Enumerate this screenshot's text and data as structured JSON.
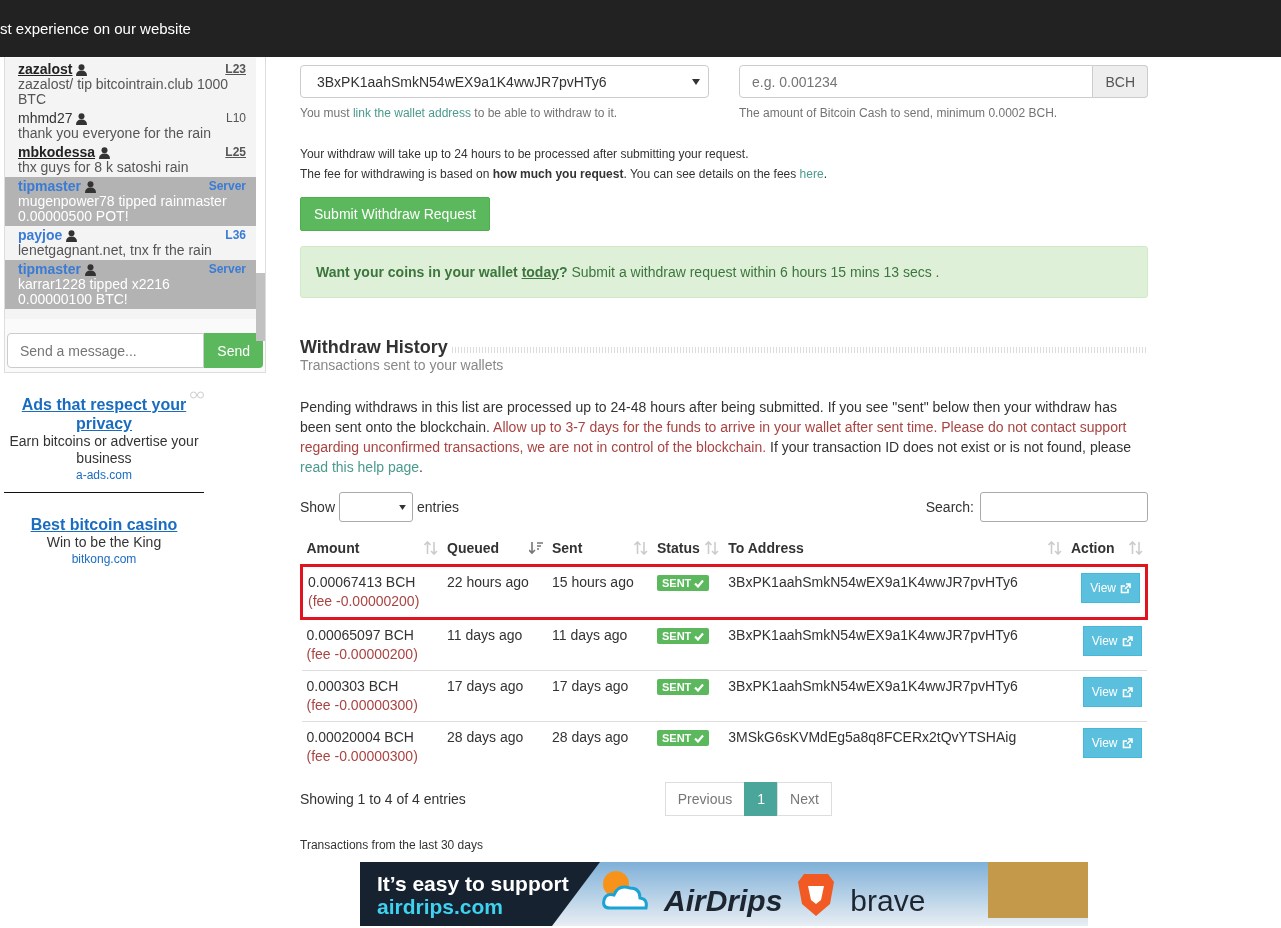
{
  "cookie_bar": {
    "text": "st experience on our website"
  },
  "chat": {
    "messages": [
      {
        "kind": "linked",
        "user": "zazalost",
        "level": "L23",
        "text": "zazalost/ tip bitcointrain.club 1000 BTC"
      },
      {
        "kind": "member",
        "user": "mhmd27",
        "level": "L10",
        "text": "thank you everyone for the rain"
      },
      {
        "kind": "linked",
        "user": "mbkodessa",
        "level": "L25",
        "text": "thx guys for 8 k satoshi rain"
      },
      {
        "kind": "server",
        "user": "tipmaster",
        "level": "Server",
        "text": "mugenpower78 tipped rainmaster 0.00000500 POT!"
      },
      {
        "kind": "vip",
        "user": "payjoe",
        "level": "L36",
        "text": "lenetgagnant.net, tnx fr the rain"
      },
      {
        "kind": "server",
        "user": "tipmaster",
        "level": "Server",
        "text": "karrar1228 tipped x2216 0.00000100 BTC!"
      }
    ],
    "input": {
      "placeholder": "Send a message..."
    },
    "send": "Send"
  },
  "ads": [
    {
      "title": "Ads that respect your privacy",
      "text": "Earn bitcoins or advertise your business",
      "domain": "a-ads.com"
    },
    {
      "title": "Best bitcoin casino",
      "text": "Win to be the King",
      "domain": "bitkong.com"
    }
  ],
  "withdraw_form": {
    "address": "3BxPK1aahSmkN54wEX9a1K4wwJR7pvHTy6",
    "address_help": {
      "before": "You must ",
      "link": "link the wallet address",
      "after": " to be able to withdraw to it."
    },
    "amount_placeholder": "e.g. 0.001234",
    "amount_unit": "BCH",
    "amount_help": "The amount of Bitcoin Cash to send, minimum 0.0002 BCH.",
    "notes": [
      "Your withdraw will take up to 24 hours to be processed after submitting your request."
    ],
    "fee_note": {
      "text": "The fee for withdrawing is based on **how much you request**. You can see details on the fees ",
      "link": "here",
      "after": "."
    },
    "submit": "Submit Withdraw Request",
    "alert": {
      "strong": "Want your coins in your wallet ",
      "link": "today",
      "rest": "? Submit a withdraw request within 6 hours 15 mins 13 secs ."
    }
  },
  "history": {
    "title": "Withdraw History",
    "subtitle": "Transactions sent to your wallets",
    "intro": {
      "plain": "Pending withdraws in this list are processed up to 24-48 hours after being submitted. If you see \"sent\" below then your withdraw has been sent onto the blockchain. ",
      "warning": "Allow up to 3-7 days for the funds to arrive in your wallet after sent time. Please do not contact support regarding unconfirmed transactions, we are not in control of the blockchain.",
      "plain2": " If your transaction ID does not exist or is not found, please ",
      "link": "read this help page",
      "end": "."
    },
    "show_label": "Show",
    "entries_label": "entries",
    "search_label": "Search:",
    "columns": [
      {
        "label": "Amount",
        "sorted": false
      },
      {
        "label": "Queued",
        "sorted": true
      },
      {
        "label": "Sent",
        "sorted": false
      },
      {
        "label": "Status",
        "sorted": false
      },
      {
        "label": "To Address",
        "sorted": false
      },
      {
        "label": "Action",
        "sorted": false
      }
    ],
    "rows": [
      {
        "amount": "0.00067413 BCH",
        "fee": "(fee -0.00000200)",
        "queued": "22 hours ago",
        "sent": "15 hours ago",
        "status": "SENT",
        "address": "3BxPK1aahSmkN54wEX9a1K4wwJR7pvHTy6",
        "action": "View",
        "highlighted": true
      },
      {
        "amount": "0.00065097 BCH",
        "fee": "(fee -0.00000200)",
        "queued": "11 days ago",
        "sent": "11 days ago",
        "status": "SENT",
        "address": "3BxPK1aahSmkN54wEX9a1K4wwJR7pvHTy6",
        "action": "View",
        "highlighted": false
      },
      {
        "amount": "0.000303 BCH",
        "fee": "(fee -0.00000300)",
        "queued": "17 days ago",
        "sent": "17 days ago",
        "status": "SENT",
        "address": "3BxPK1aahSmkN54wEX9a1K4wwJR7pvHTy6",
        "action": "View",
        "highlighted": false
      },
      {
        "amount": "0.00020004 BCH",
        "fee": "(fee -0.00000300)",
        "queued": "28 days ago",
        "sent": "28 days ago",
        "status": "SENT",
        "address": "3MSkG6sKVMdEg5a8q8FCERx2tQvYTSHAig",
        "action": "View",
        "highlighted": false
      }
    ],
    "info": "Showing 1 to 4 of 4 entries",
    "pages": [
      {
        "label": "Previous",
        "selected": false
      },
      {
        "label": "1",
        "selected": true
      },
      {
        "label": "Next",
        "selected": false
      }
    ],
    "footnote": "Transactions from the last 30 days"
  },
  "banner": {
    "line1": "It’s easy to support",
    "line2": "airdrips.com",
    "brand1": "AirDrips",
    "brand2": "brave"
  }
}
